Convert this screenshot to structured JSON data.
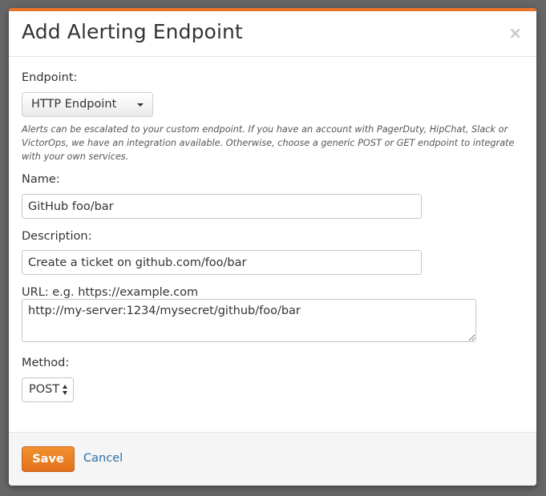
{
  "dialog": {
    "title": "Add Alerting Endpoint",
    "close_glyph": "×"
  },
  "endpoint": {
    "label": "Endpoint:",
    "selected": "HTTP Endpoint",
    "help": "Alerts can be escalated to your custom endpoint. If you have an account with PagerDuty, HipChat, Slack or VictorOps, we have an integration available. Otherwise, choose a generic POST or GET endpoint to integrate with your own services."
  },
  "name": {
    "label": "Name:",
    "value": "GitHub foo/bar"
  },
  "description": {
    "label": "Description:",
    "value": "Create a ticket on github.com/foo/bar"
  },
  "url": {
    "label": "URL: e.g. https://example.com",
    "value": "http://my-server:1234/mysecret/github/foo/bar"
  },
  "method": {
    "label": "Method:",
    "selected": "POST"
  },
  "footer": {
    "save_label": "Save",
    "cancel_label": "Cancel"
  },
  "colors": {
    "accent": "#e8742a",
    "save_button": "#ed8324",
    "link": "#2a6fa8"
  }
}
